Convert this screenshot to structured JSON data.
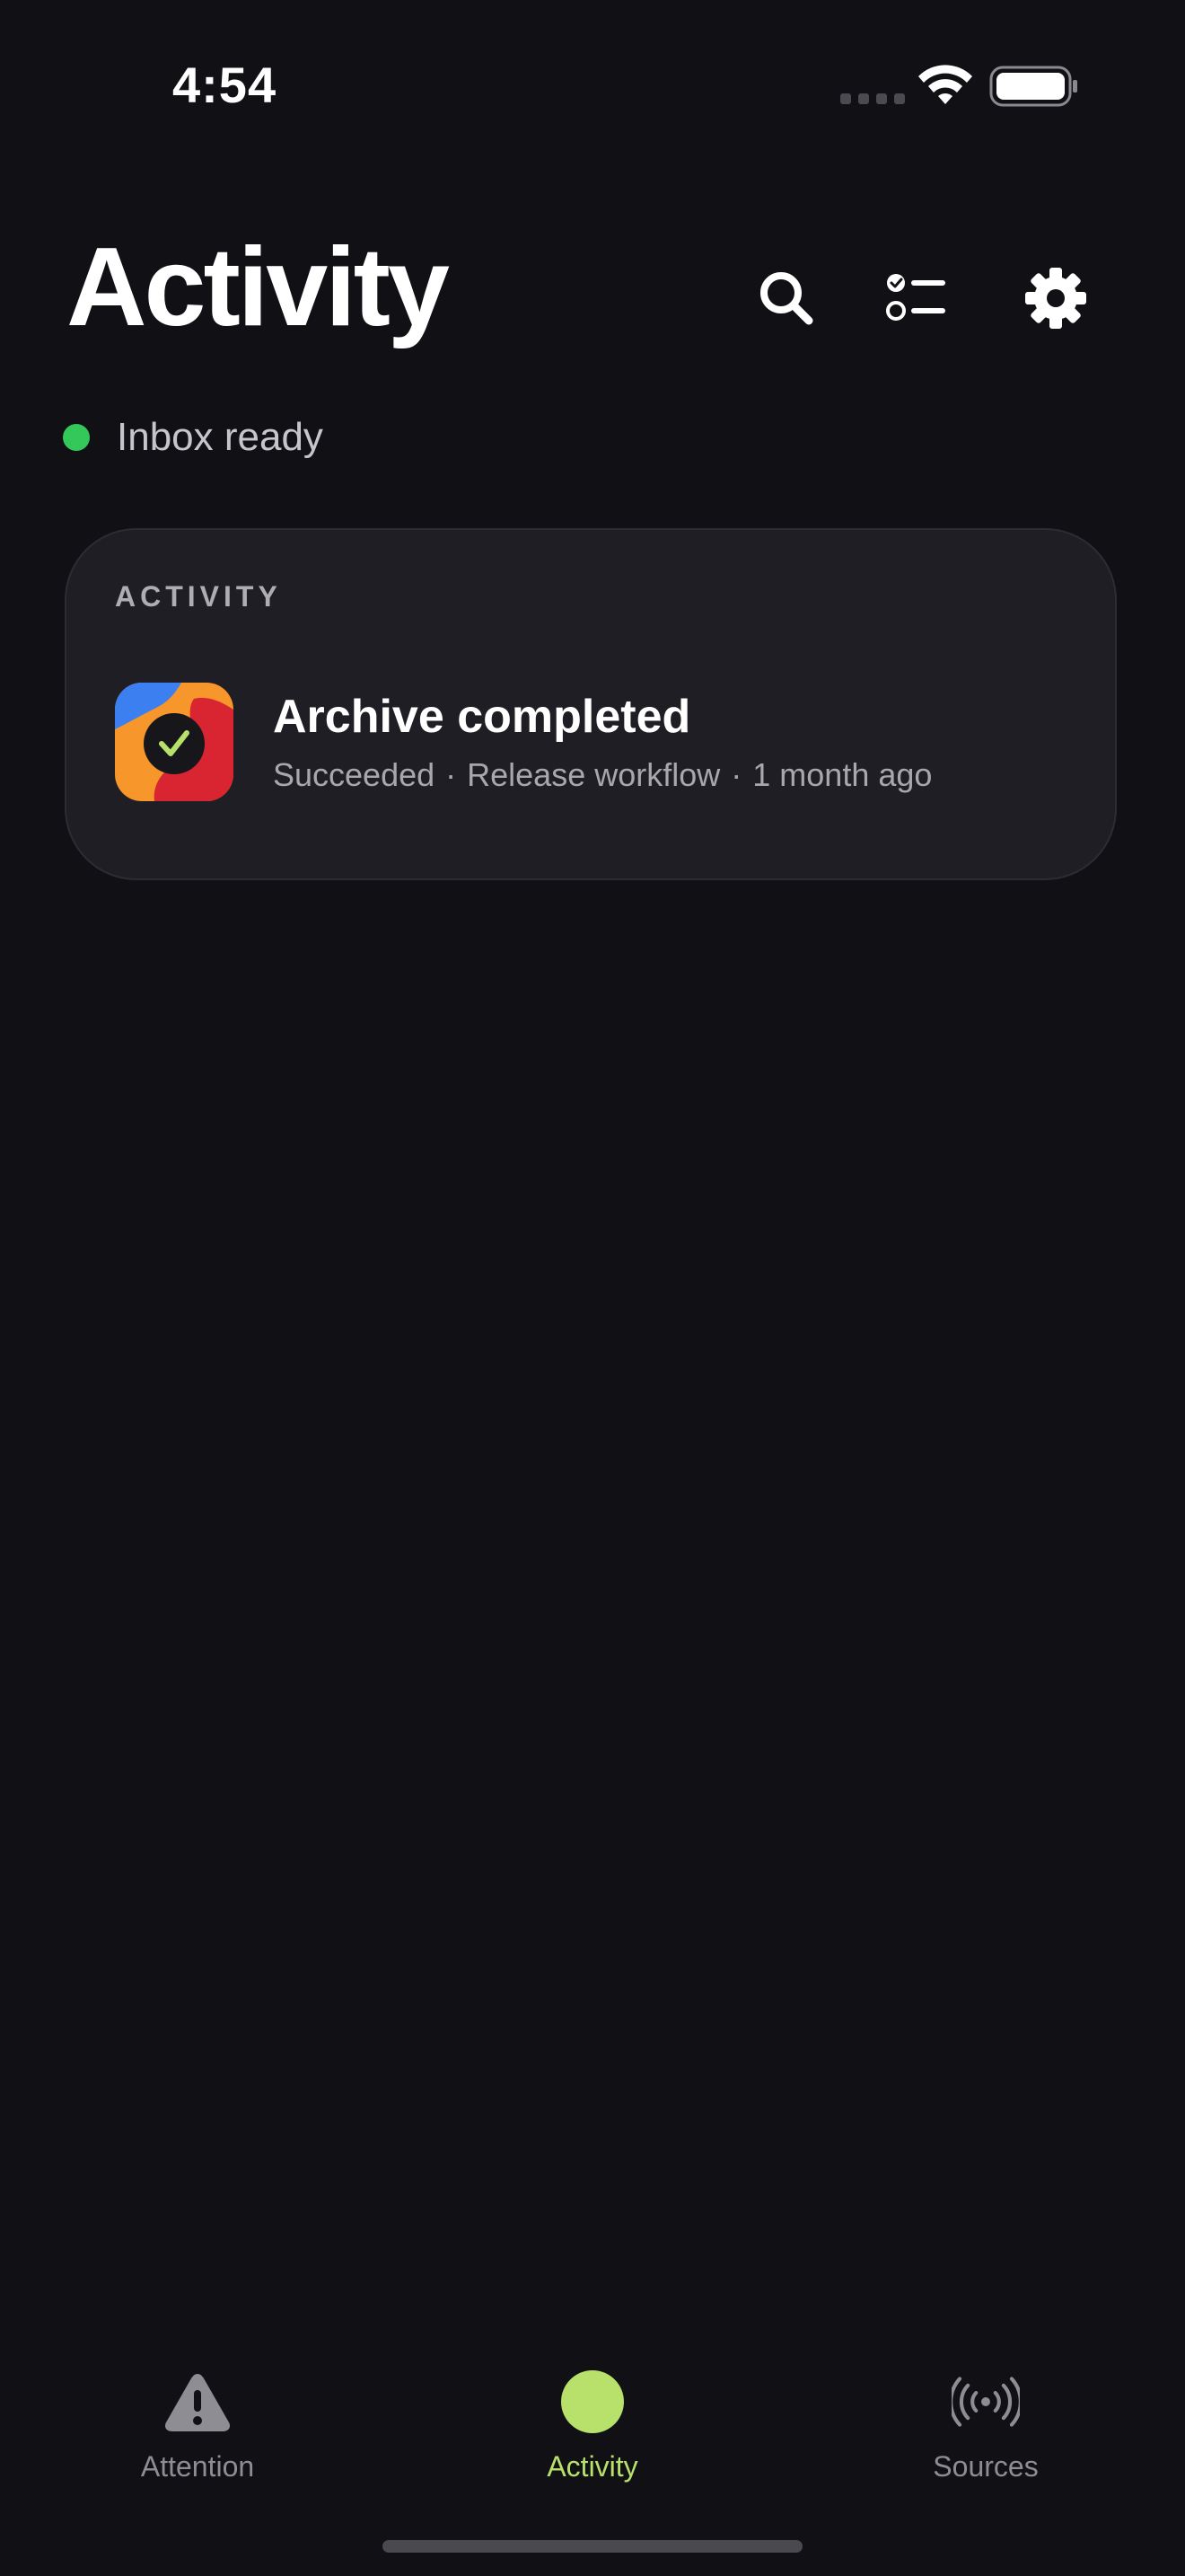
{
  "status_bar": {
    "time": "4:54",
    "icons": [
      "cellular-signal-icon",
      "wifi-icon",
      "battery-icon"
    ]
  },
  "header": {
    "title": "Activity",
    "actions": [
      {
        "icon": "search-icon",
        "label": "Search"
      },
      {
        "icon": "checklist-icon",
        "label": "Tasks"
      },
      {
        "icon": "gear-icon",
        "label": "Settings"
      }
    ]
  },
  "status": {
    "text": "Inbox ready",
    "color": "#34c759"
  },
  "card": {
    "section_label": "ACTIVITY",
    "items": [
      {
        "title": "Archive completed",
        "status": "Succeeded",
        "workflow": "Release workflow",
        "time": "1 month ago",
        "separator": "·",
        "icon": "archive-app-icon"
      }
    ]
  },
  "tabs": [
    {
      "label": "Attention",
      "icon": "warning-triangle-icon",
      "active": false
    },
    {
      "label": "Activity",
      "icon": "activity-dot-icon",
      "active": true
    },
    {
      "label": "Sources",
      "icon": "broadcast-icon",
      "active": false
    }
  ],
  "colors": {
    "background": "#111015",
    "card": "#1f1e24",
    "accent": "#b7e16b",
    "success": "#34c759",
    "muted": "#8e8d93"
  }
}
